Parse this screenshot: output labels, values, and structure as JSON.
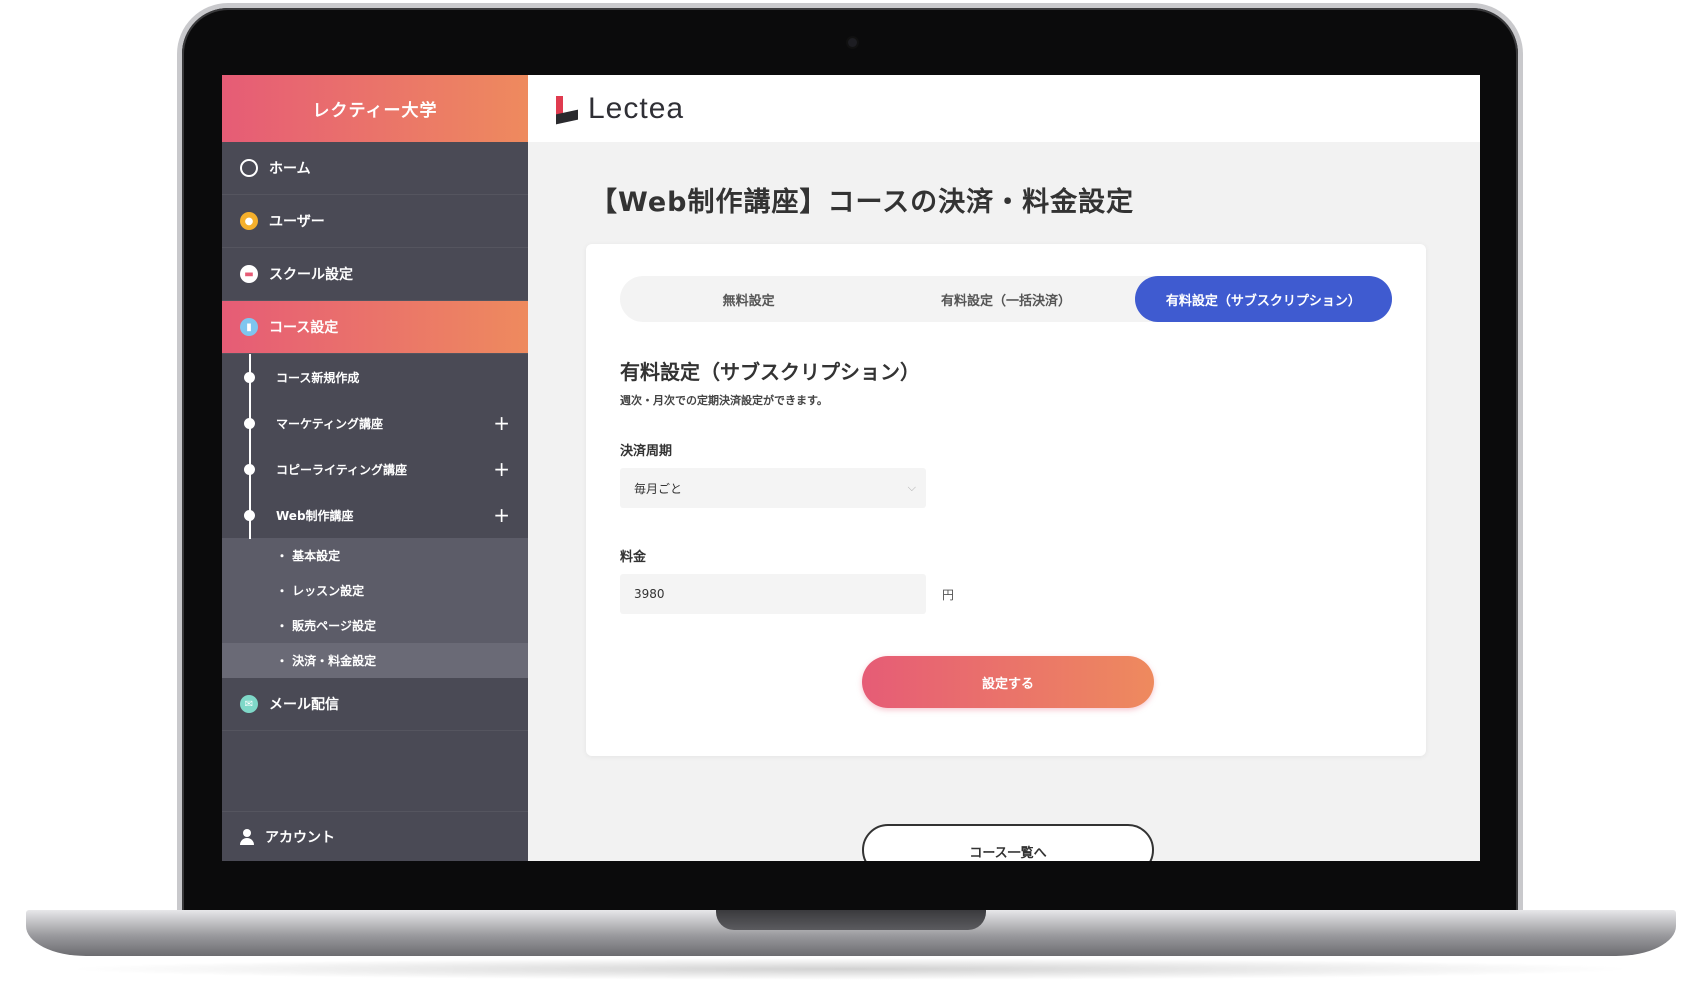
{
  "sidebar": {
    "school_name": "レクティー大学",
    "items": [
      {
        "label": "ホーム",
        "icon": "gauge-icon"
      },
      {
        "label": "ユーザー",
        "icon": "user-icon"
      },
      {
        "label": "スクール設定",
        "icon": "school-icon"
      },
      {
        "label": "コース設定",
        "icon": "course-icon",
        "active": true
      }
    ],
    "course_children": [
      {
        "label": "コース新規作成",
        "expandable": false
      },
      {
        "label": "マーケティング講座",
        "expandable": true,
        "expand_symbol": "+"
      },
      {
        "label": "コピーライティング講座",
        "expandable": true,
        "expand_symbol": "+"
      },
      {
        "label": "Web制作講座",
        "expandable": true,
        "expand_symbol": "+"
      }
    ],
    "web_course_children": [
      {
        "label": "・ 基本設定"
      },
      {
        "label": "・ レッスン設定"
      },
      {
        "label": "・ 販売ページ設定"
      },
      {
        "label": "・ 決済・料金設定",
        "current": true
      }
    ],
    "mail": {
      "label": "メール配信",
      "icon": "mail-icon"
    },
    "account": {
      "label": "アカウント",
      "icon": "person-icon"
    }
  },
  "header": {
    "logo_text": "Lectea"
  },
  "main": {
    "page_title": "【Web制作講座】コースの決済・料金設定",
    "tabs": [
      {
        "label": "無料設定",
        "active": false
      },
      {
        "label": "有料設定（一括決済）",
        "active": false
      },
      {
        "label": "有料設定（サブスクリプション）",
        "active": true
      }
    ],
    "section_title": "有料設定（サブスクリプション）",
    "section_desc": "週次・月次での定期決済設定ができます。",
    "cycle_label": "決済周期",
    "cycle_value": "毎月ごと",
    "price_label": "料金",
    "price_value": "3980",
    "price_unit": "円",
    "submit_label": "設定する",
    "back_label": "コース一覧へ"
  },
  "colors": {
    "accent_gradient_start": "#e65c76",
    "accent_gradient_end": "#ee8a5e",
    "active_tab": "#3f5bd0",
    "sidebar_bg": "#4a4a55"
  }
}
